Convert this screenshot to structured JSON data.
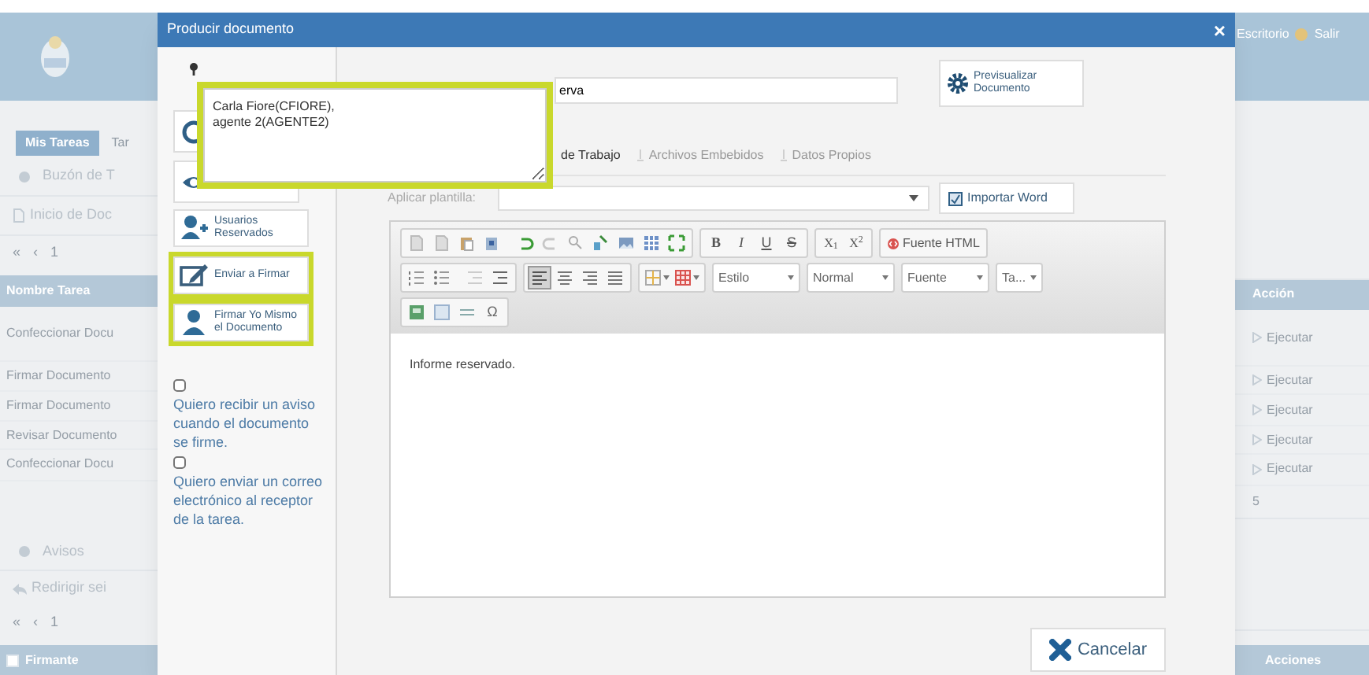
{
  "background": {
    "header_links": [
      "Escritorio",
      "Salir"
    ],
    "tabs": [
      {
        "label": "Mis Tareas",
        "selected": true
      },
      {
        "label": "Tar",
        "selected": false
      }
    ],
    "inbox_title": "Buzón de T",
    "start_link": "Inicio de Doc",
    "pager_1": [
      "«",
      "‹",
      "1"
    ],
    "tasks": {
      "columns": [
        "Nombre Tarea",
        "Acción"
      ],
      "rows": [
        [
          "Confeccionar Docu",
          "Ejecutar"
        ],
        [
          "Firmar Documento",
          "Ejecutar"
        ],
        [
          "Firmar Documento",
          "Ejecutar"
        ],
        [
          "Revisar Documento",
          "Ejecutar"
        ],
        [
          "Confeccionar Docu",
          "Ejecutar"
        ]
      ],
      "footer": "5"
    },
    "notices_title": "Avisos",
    "redirect_link": "Redirigir sei",
    "pager_2": [
      "«",
      "‹",
      "1"
    ],
    "signers": {
      "columns": [
        "Firmante",
        "Acciones"
      ]
    }
  },
  "modal": {
    "title": "Producir documento",
    "close": "×",
    "side_buttons": [
      {
        "label": "Usuarios Reservados",
        "highlighted": false
      },
      {
        "label": "Enviar a Firmar",
        "highlighted": true
      },
      {
        "label": "Firmar Yo Mismo el Documento",
        "highlighted": true
      }
    ],
    "options": [
      {
        "label": "Quiero recibir un aviso cuando el documento se firme.",
        "checked": false
      },
      {
        "label": "Quiero enviar un correo electrónico al receptor de la tarea.",
        "checked": false
      }
    ],
    "recipients": "Carla Fiore(CFIORE),\nagente 2(AGENTE2)",
    "reference_value": "erva",
    "preview_button": "Previsualizar Documento",
    "tabs": [
      {
        "label": "de Trabajo",
        "selected": true
      },
      {
        "label": "Archivos Embebidos",
        "selected": false
      },
      {
        "label": "Datos Propios",
        "selected": false
      }
    ],
    "template_label": "Aplicar plantilla:",
    "import_button": "Importar Word",
    "editor": {
      "format_buttons": [
        "B",
        "I",
        "U",
        "S"
      ],
      "script_buttons": [
        "X$_{1}$",
        "X$^{2}$"
      ],
      "source_button": "Fuente HTML",
      "dropdowns": [
        "Estilo",
        "Normal",
        "Fuente",
        "Ta..."
      ],
      "special_char": "Ω",
      "body": "Informe reservado."
    },
    "cancel_button": "Cancelar"
  }
}
